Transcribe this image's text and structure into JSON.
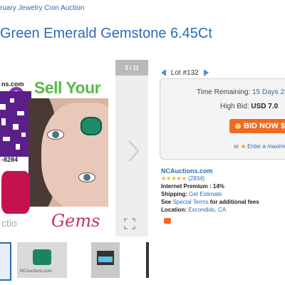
{
  "breadcrumb": "ruary Jewelry Coin Auction",
  "title": "Green Emerald Gemstone 6.45Ct",
  "gallery": {
    "counter": "3 / 11",
    "image_text": {
      "site": "ns.com",
      "sell": "Sell Your",
      "gems": "Gems",
      "phone": "-8284",
      "watermark": "ctio"
    },
    "thumb_caption": "NCAuctions.com"
  },
  "lot": {
    "label": "Lot #132",
    "time_remaining_label": "Time Remaining:",
    "time_remaining_value": "15 Days 23",
    "high_bid_label": "High Bid:",
    "high_bid_value": "USD 7.0",
    "bid_now_label": "BID NOW $",
    "or_text": "or",
    "max_bid_link": "Enter a maximu"
  },
  "seller": {
    "name": "NCAuctions.com",
    "stars": "★★★★★",
    "rating_count": "(2834)",
    "premium": "Internet Premium : 14%",
    "shipping_label": "Shipping:",
    "shipping_value": "Get Estimate",
    "terms_prefix": "See",
    "terms_link": "Special Terms",
    "terms_suffix": "for additional fees",
    "location_label": "Location:",
    "location_value": "Escondido, CA"
  },
  "colors": {
    "link": "#2a6cb7",
    "bid_button": "#f16a22",
    "star": "#f3a91a"
  }
}
